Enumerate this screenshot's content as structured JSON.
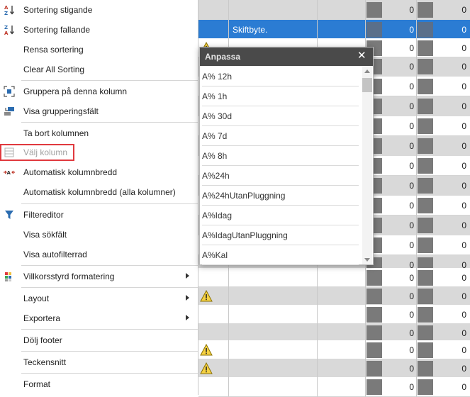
{
  "context_menu": {
    "items": [
      {
        "label": "Sortering stigande",
        "icon": "sort-ascending-icon"
      },
      {
        "label": "Sortering fallande",
        "icon": "sort-descending-icon"
      },
      {
        "label": "Rensa sortering",
        "icon": ""
      },
      {
        "label": "Clear All Sorting",
        "icon": ""
      },
      {
        "label": "Gruppera på denna kolumn",
        "icon": "group-by-column-icon"
      },
      {
        "label": "Visa grupperingsfält",
        "icon": "group-panel-icon"
      },
      {
        "label": "Ta bort kolumnen",
        "icon": ""
      },
      {
        "label": "Välj kolumn",
        "icon": "column-chooser-icon",
        "disabled": true,
        "highlighted": true
      },
      {
        "label": "Automatisk kolumnbredd",
        "icon": "best-fit-icon"
      },
      {
        "label": "Automatisk kolumnbredd (alla kolumner)",
        "icon": ""
      },
      {
        "label": "Filtereditor",
        "icon": "filter-icon"
      },
      {
        "label": "Visa sökfält",
        "icon": ""
      },
      {
        "label": "Visa autofilterrad",
        "icon": ""
      },
      {
        "label": "Villkorsstyrd formatering",
        "icon": "conditional-formatting-icon",
        "submenu": true
      },
      {
        "label": "Layout",
        "icon": "",
        "submenu": true
      },
      {
        "label": "Exportera",
        "icon": "",
        "submenu": true
      },
      {
        "label": "Dölj footer",
        "icon": ""
      },
      {
        "label": "Teckensnitt",
        "icon": ""
      },
      {
        "label": "Format",
        "icon": ""
      }
    ]
  },
  "popup": {
    "title": "Anpassa",
    "close_icon": "close-icon",
    "items": [
      "A% 12h",
      "A% 1h",
      "A% 30d",
      "A% 7d",
      "A% 8h",
      "A%24h",
      "A%24hUtanPluggning",
      "A%Idag",
      "A%IdagUtanPluggning",
      "A%Kal"
    ]
  },
  "grid": {
    "selected_row_text": "Skiftbyte.",
    "value": "0",
    "colors": {
      "selection": "#2b7cd3",
      "highlight_border": "#e0393e",
      "popup_header": "#4a4a4a"
    }
  }
}
